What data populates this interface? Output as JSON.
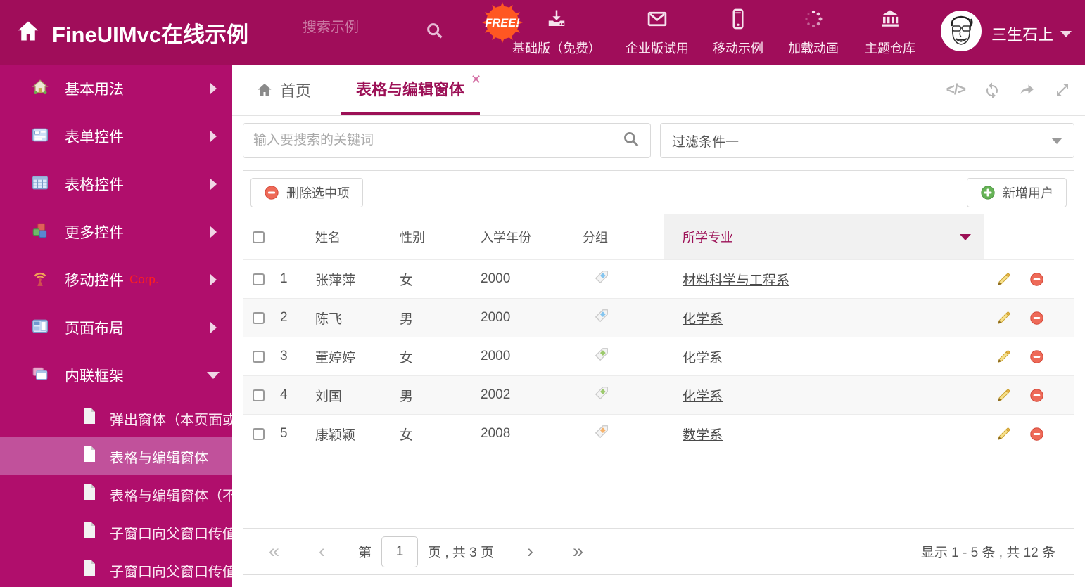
{
  "colors": {
    "header_bg": "#A00D5A",
    "sidebar_bg": "#B00E6C",
    "sidebar_selected": "#C1519B",
    "accent": "#9C1056",
    "badge_orange": "#FF5722",
    "corp_red": "#FF1F1F",
    "tag_blue": "#85C5EF",
    "tag_green": "#9CC96C",
    "tag_orange": "#F6B26B"
  },
  "header": {
    "title": "FineUIMvc在线示例",
    "search_placeholder": "搜索示例",
    "free_badge": "FREE!",
    "actions": [
      {
        "label": "基础版（免费）",
        "icon": "download-icon"
      },
      {
        "label": "企业版试用",
        "icon": "envelope-icon"
      },
      {
        "label": "移动示例",
        "icon": "mobile-icon"
      },
      {
        "label": "加载动画",
        "icon": "spinner-icon"
      },
      {
        "label": "主题仓库",
        "icon": "bank-icon"
      }
    ],
    "username": "三生石上"
  },
  "sidebar": {
    "items": [
      {
        "label": "基本用法",
        "icon": "home-icon"
      },
      {
        "label": "表单控件",
        "icon": "form-icon"
      },
      {
        "label": "表格控件",
        "icon": "table-icon"
      },
      {
        "label": "更多控件",
        "icon": "cubes-icon"
      },
      {
        "label": "移动控件",
        "badge": "Corp.",
        "icon": "antenna-icon"
      },
      {
        "label": "页面布局",
        "icon": "layout-icon"
      },
      {
        "label": "内联框架",
        "icon": "frames-icon",
        "expanded": true
      }
    ],
    "subitems": [
      {
        "label": "弹出窗体（本页面或..."
      },
      {
        "label": "表格与编辑窗体",
        "active": true
      },
      {
        "label": "表格与编辑窗体（不..."
      },
      {
        "label": "子窗口向父窗口传值"
      },
      {
        "label": "子窗口向父窗口传值..."
      }
    ]
  },
  "tabs": {
    "home_label": "首页",
    "active_label": "表格与编辑窗体",
    "tools": [
      "code-icon",
      "refresh-icon",
      "forward-icon",
      "fullscreen-icon"
    ]
  },
  "filters": {
    "search_placeholder": "输入要搜索的关键词",
    "filter_value": "过滤条件一"
  },
  "toolbar": {
    "delete_label": "删除选中项",
    "add_label": "新增用户"
  },
  "table": {
    "columns": {
      "name": "姓名",
      "gender": "性别",
      "year": "入学年份",
      "group": "分组",
      "major": "所学专业"
    },
    "rows": [
      {
        "num": "1",
        "name": "张萍萍",
        "gender": "女",
        "year": "2000",
        "tag": "blue",
        "major": "材料科学与工程系"
      },
      {
        "num": "2",
        "name": "陈飞",
        "gender": "男",
        "year": "2000",
        "tag": "blue",
        "major": "化学系"
      },
      {
        "num": "3",
        "name": "董婷婷",
        "gender": "女",
        "year": "2000",
        "tag": "green",
        "major": "化学系"
      },
      {
        "num": "4",
        "name": "刘国",
        "gender": "男",
        "year": "2002",
        "tag": "green",
        "major": "化学系"
      },
      {
        "num": "5",
        "name": "康颖颖",
        "gender": "女",
        "year": "2008",
        "tag": "orange",
        "major": "数学系"
      }
    ]
  },
  "pagination": {
    "prefix": "第",
    "page": "1",
    "suffix": "页 , 共 3 页",
    "summary": "显示 1 - 5 条 , 共 12 条"
  }
}
